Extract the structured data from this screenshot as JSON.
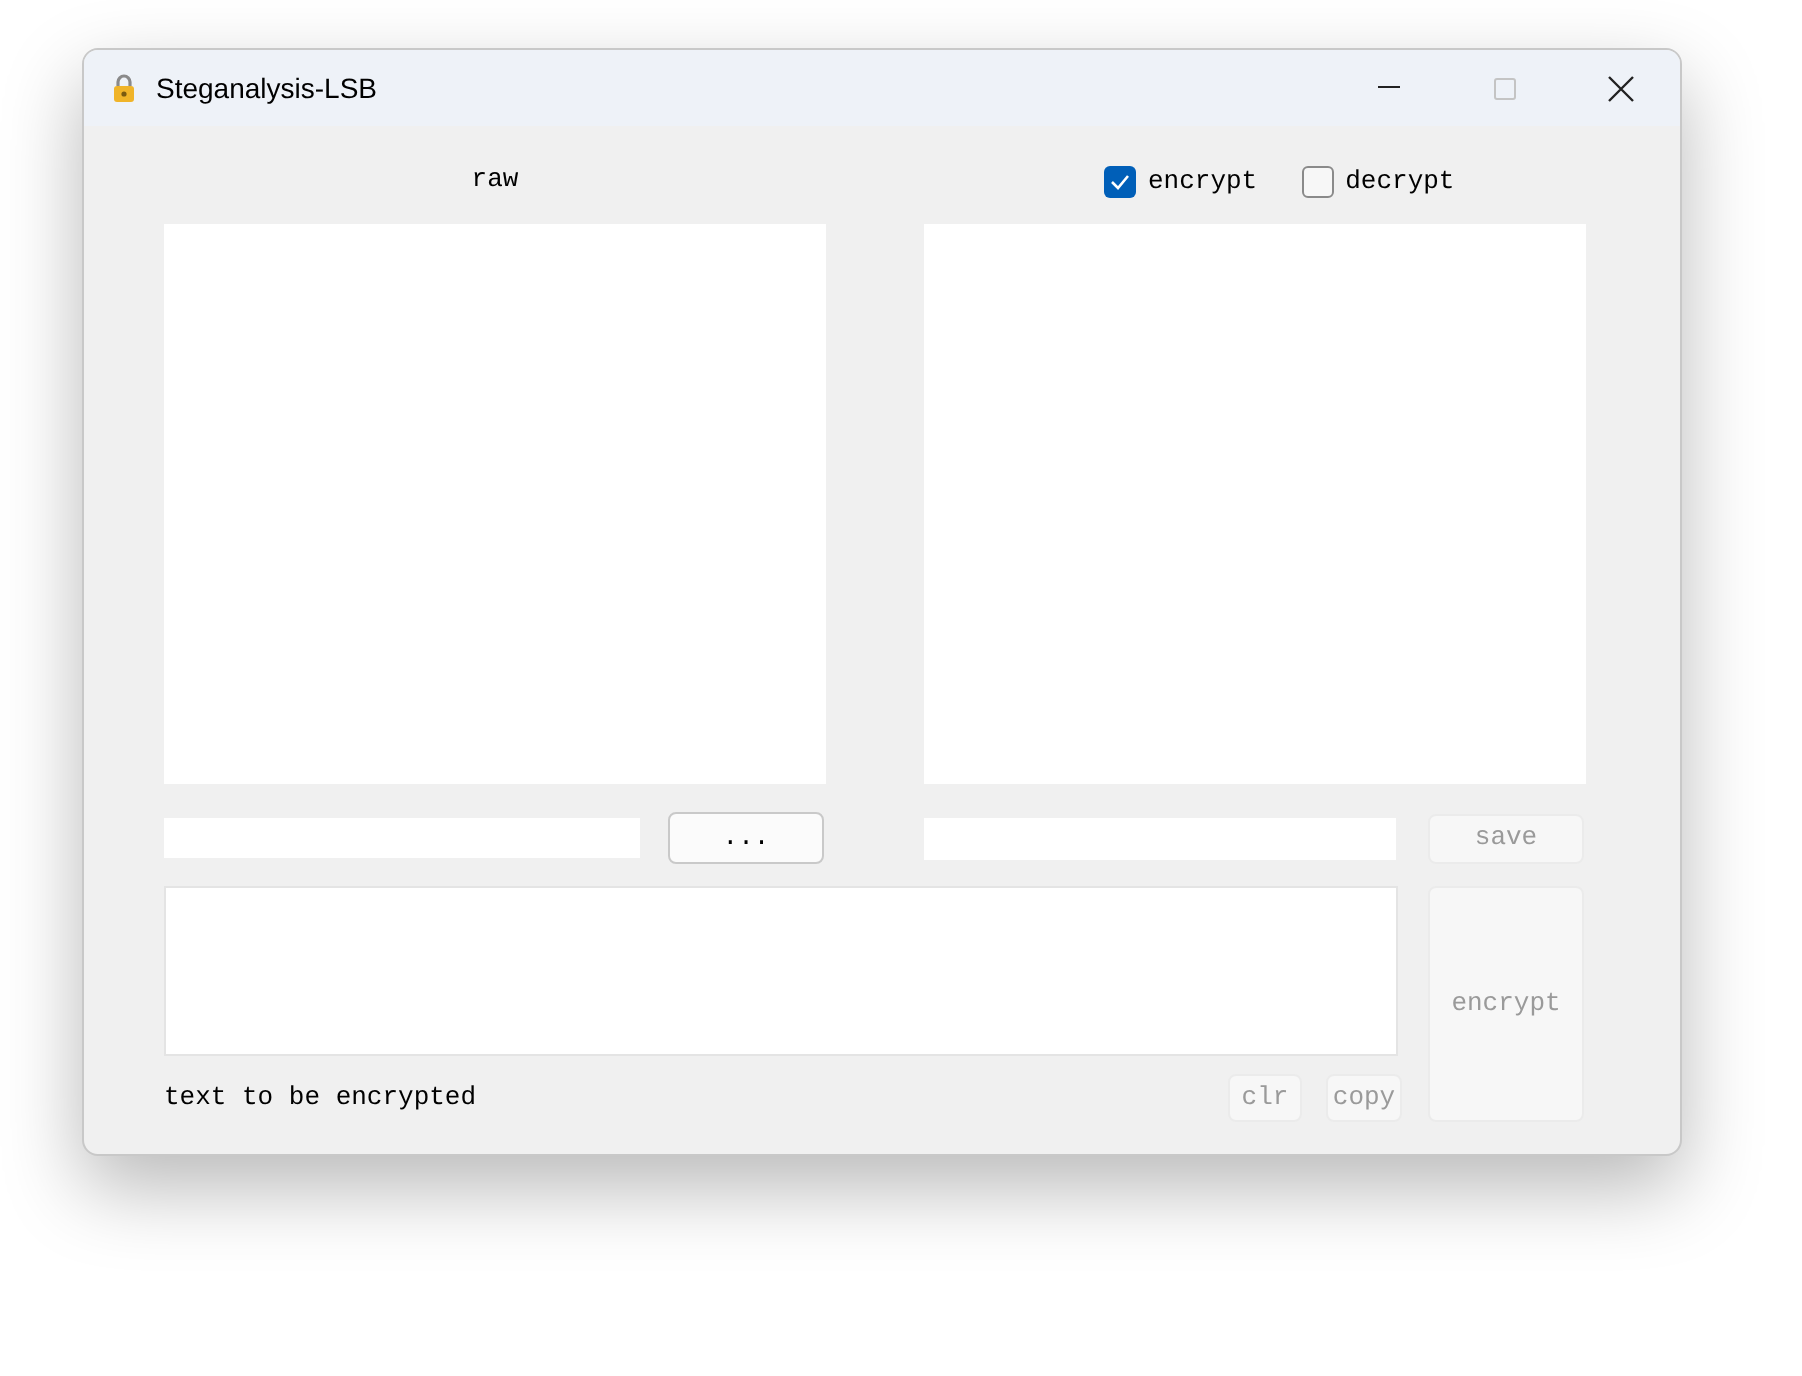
{
  "window": {
    "title": "Steganalysis-LSB",
    "maximize_disabled": true
  },
  "raw_label": "raw",
  "modes": [
    {
      "label": "encrypt",
      "checked": true
    },
    {
      "label": "decrypt",
      "checked": false
    }
  ],
  "browse_button": {
    "label": "...",
    "disabled": false
  },
  "save_button": {
    "label": "save",
    "disabled": true
  },
  "message_label": "text to be encrypted",
  "clear_button": {
    "label": "clr",
    "disabled": true
  },
  "copy_button": {
    "label": "copy",
    "disabled": true
  },
  "run_button": {
    "label": "encrypt",
    "disabled": true
  }
}
